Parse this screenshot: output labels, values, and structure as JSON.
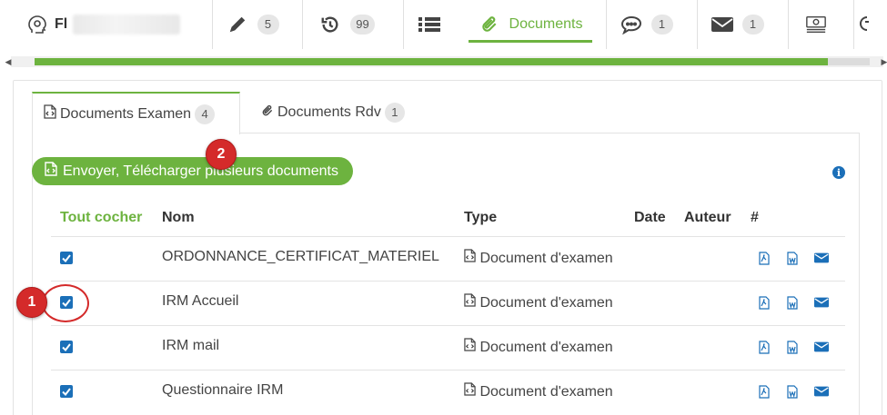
{
  "top_tabs": [
    {
      "label": "Fl",
      "icon": "user-head-icon",
      "badge": null
    },
    {
      "label": "",
      "icon": "pencil-icon",
      "badge": "5"
    },
    {
      "label": "",
      "icon": "history-icon",
      "badge": "99"
    },
    {
      "label": "",
      "icon": "list-icon",
      "badge": null
    },
    {
      "label": "Documents",
      "icon": "paperclip-icon",
      "badge": null
    },
    {
      "label": "",
      "icon": "comment-icon",
      "badge": "1"
    },
    {
      "label": "",
      "icon": "envelope-icon",
      "badge": "1"
    },
    {
      "label": "",
      "icon": "money-icon",
      "badge": null
    }
  ],
  "sub_tabs": [
    {
      "label": "Documents Examen",
      "badge": "4",
      "icon": "file-code-icon"
    },
    {
      "label": "Documents Rdv",
      "badge": "1",
      "icon": "paperclip-icon"
    }
  ],
  "upload_button": {
    "label": "Envoyer, Télécharger plusieurs documents"
  },
  "table": {
    "headers": {
      "check_all": "Tout cocher",
      "name": "Nom",
      "type": "Type",
      "date": "Date",
      "author": "Auteur",
      "hash": "#"
    },
    "rows": [
      {
        "checked": true,
        "name": "ORDONNANCE_CERTIFICAT_MATERIEL",
        "type": "Document d'examen",
        "date": "",
        "author": ""
      },
      {
        "checked": true,
        "name": "IRM Accueil",
        "type": "Document d'examen",
        "date": "",
        "author": ""
      },
      {
        "checked": true,
        "name": "IRM mail",
        "type": "Document d'examen",
        "date": "",
        "author": ""
      },
      {
        "checked": true,
        "name": "Questionnaire IRM",
        "type": "Document d'examen",
        "date": "",
        "author": ""
      }
    ]
  },
  "markers": [
    {
      "label": "1"
    },
    {
      "label": "2"
    }
  ],
  "colors": {
    "accent": "#6db33f",
    "link": "#1b6fb8",
    "marker": "#d42a2a"
  }
}
